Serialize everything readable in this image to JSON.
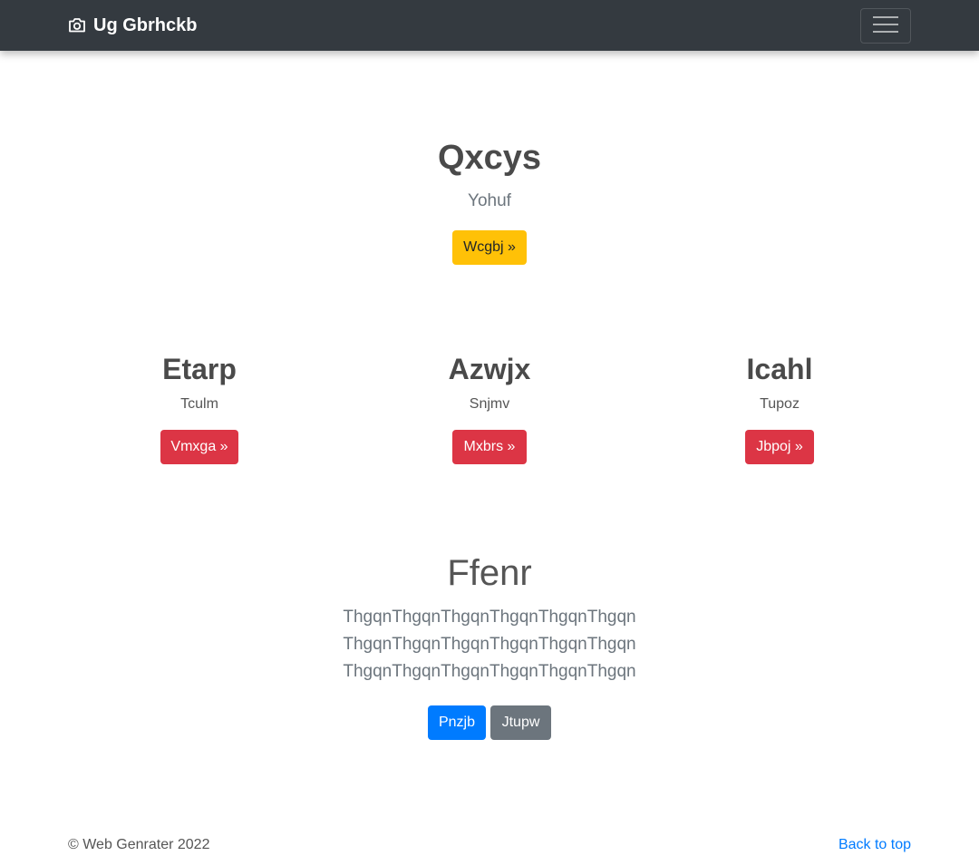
{
  "navbar": {
    "brand_icon": "camera-icon",
    "brand_text": "Ug Gbrhckb",
    "toggler_icon": "hamburger-icon"
  },
  "hero": {
    "title": "Qxcys",
    "subtitle": "Yohuf",
    "button_label": "Wcgbj »"
  },
  "columns": [
    {
      "title": "Etarp",
      "text": "Tculm",
      "button_label": "Vmxga »"
    },
    {
      "title": "Azwjx",
      "text": "Snjmv",
      "button_label": "Mxbrs »"
    },
    {
      "title": "Icahl",
      "text": "Tupoz",
      "button_label": "Jbpoj »"
    }
  ],
  "section": {
    "title": "Ffenr",
    "lead_lines": [
      "ThgqnThgqnThgqnThgqnThgqnThgqn",
      "ThgqnThgqnThgqnThgqnThgqnThgqn",
      "ThgqnThgqnThgqnThgqnThgqnThgqn"
    ],
    "primary_button": "Pnzjb",
    "secondary_button": "Jtupw"
  },
  "footer": {
    "copyright": "© Web Genrater 2022",
    "back_to_top": "Back to top"
  },
  "colors": {
    "navbar_bg": "#343a40",
    "warning": "#ffc107",
    "danger": "#dc3545",
    "primary": "#007bff",
    "secondary": "#6c757d"
  }
}
